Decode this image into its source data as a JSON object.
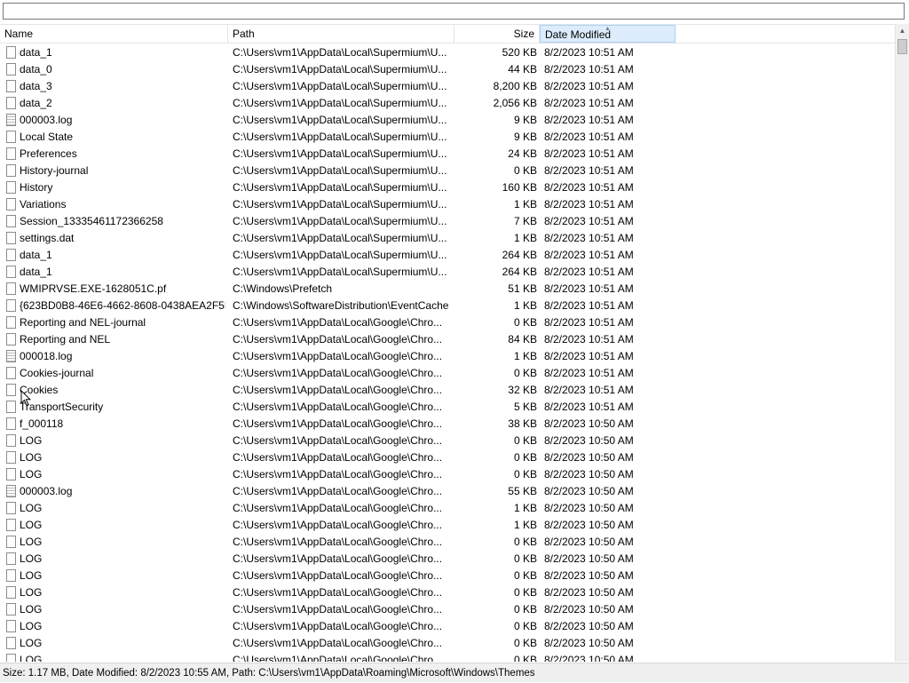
{
  "search": {
    "value": "",
    "placeholder": ""
  },
  "columns": {
    "name": "Name",
    "path": "Path",
    "size": "Size",
    "date": "Date Modified"
  },
  "sorted_column": "Date Modified",
  "rows": [
    {
      "icon": "file-icon",
      "name": "data_1",
      "path": "C:\\Users\\vm1\\AppData\\Local\\Supermium\\U...",
      "size": "520 KB",
      "date": "8/2/2023 10:51 AM"
    },
    {
      "icon": "file-icon",
      "name": "data_0",
      "path": "C:\\Users\\vm1\\AppData\\Local\\Supermium\\U...",
      "size": "44 KB",
      "date": "8/2/2023 10:51 AM"
    },
    {
      "icon": "file-icon",
      "name": "data_3",
      "path": "C:\\Users\\vm1\\AppData\\Local\\Supermium\\U...",
      "size": "8,200 KB",
      "date": "8/2/2023 10:51 AM"
    },
    {
      "icon": "file-icon",
      "name": "data_2",
      "path": "C:\\Users\\vm1\\AppData\\Local\\Supermium\\U...",
      "size": "2,056 KB",
      "date": "8/2/2023 10:51 AM"
    },
    {
      "icon": "log-file-icon",
      "name": "000003.log",
      "path": "C:\\Users\\vm1\\AppData\\Local\\Supermium\\U...",
      "size": "9 KB",
      "date": "8/2/2023 10:51 AM"
    },
    {
      "icon": "file-icon",
      "name": "Local State",
      "path": "C:\\Users\\vm1\\AppData\\Local\\Supermium\\U...",
      "size": "9 KB",
      "date": "8/2/2023 10:51 AM"
    },
    {
      "icon": "file-icon",
      "name": "Preferences",
      "path": "C:\\Users\\vm1\\AppData\\Local\\Supermium\\U...",
      "size": "24 KB",
      "date": "8/2/2023 10:51 AM"
    },
    {
      "icon": "file-icon",
      "name": "History-journal",
      "path": "C:\\Users\\vm1\\AppData\\Local\\Supermium\\U...",
      "size": "0 KB",
      "date": "8/2/2023 10:51 AM"
    },
    {
      "icon": "file-icon",
      "name": "History",
      "path": "C:\\Users\\vm1\\AppData\\Local\\Supermium\\U...",
      "size": "160 KB",
      "date": "8/2/2023 10:51 AM"
    },
    {
      "icon": "file-icon",
      "name": "Variations",
      "path": "C:\\Users\\vm1\\AppData\\Local\\Supermium\\U...",
      "size": "1 KB",
      "date": "8/2/2023 10:51 AM"
    },
    {
      "icon": "file-icon",
      "name": "Session_13335461172366258",
      "path": "C:\\Users\\vm1\\AppData\\Local\\Supermium\\U...",
      "size": "7 KB",
      "date": "8/2/2023 10:51 AM"
    },
    {
      "icon": "file-icon",
      "name": "settings.dat",
      "path": "C:\\Users\\vm1\\AppData\\Local\\Supermium\\U...",
      "size": "1 KB",
      "date": "8/2/2023 10:51 AM"
    },
    {
      "icon": "file-icon",
      "name": "data_1",
      "path": "C:\\Users\\vm1\\AppData\\Local\\Supermium\\U...",
      "size": "264 KB",
      "date": "8/2/2023 10:51 AM"
    },
    {
      "icon": "file-icon",
      "name": "data_1",
      "path": "C:\\Users\\vm1\\AppData\\Local\\Supermium\\U...",
      "size": "264 KB",
      "date": "8/2/2023 10:51 AM"
    },
    {
      "icon": "file-icon",
      "name": "WMIPRVSE.EXE-1628051C.pf",
      "path": "C:\\Windows\\Prefetch",
      "size": "51 KB",
      "date": "8/2/2023 10:51 AM"
    },
    {
      "icon": "file-icon",
      "name": "{623BD0B8-46E6-4662-8608-0438AEA2F5E...",
      "path": "C:\\Windows\\SoftwareDistribution\\EventCache",
      "size": "1 KB",
      "date": "8/2/2023 10:51 AM"
    },
    {
      "icon": "file-icon",
      "name": "Reporting and NEL-journal",
      "path": "C:\\Users\\vm1\\AppData\\Local\\Google\\Chro...",
      "size": "0 KB",
      "date": "8/2/2023 10:51 AM"
    },
    {
      "icon": "file-icon",
      "name": "Reporting and NEL",
      "path": "C:\\Users\\vm1\\AppData\\Local\\Google\\Chro...",
      "size": "84 KB",
      "date": "8/2/2023 10:51 AM"
    },
    {
      "icon": "log-file-icon",
      "name": "000018.log",
      "path": "C:\\Users\\vm1\\AppData\\Local\\Google\\Chro...",
      "size": "1 KB",
      "date": "8/2/2023 10:51 AM"
    },
    {
      "icon": "file-icon",
      "name": "Cookies-journal",
      "path": "C:\\Users\\vm1\\AppData\\Local\\Google\\Chro...",
      "size": "0 KB",
      "date": "8/2/2023 10:51 AM"
    },
    {
      "icon": "file-icon",
      "name": "Cookies",
      "path": "C:\\Users\\vm1\\AppData\\Local\\Google\\Chro...",
      "size": "32 KB",
      "date": "8/2/2023 10:51 AM"
    },
    {
      "icon": "file-icon",
      "name": "TransportSecurity",
      "path": "C:\\Users\\vm1\\AppData\\Local\\Google\\Chro...",
      "size": "5 KB",
      "date": "8/2/2023 10:51 AM"
    },
    {
      "icon": "file-icon",
      "name": "f_000118",
      "path": "C:\\Users\\vm1\\AppData\\Local\\Google\\Chro...",
      "size": "38 KB",
      "date": "8/2/2023 10:50 AM"
    },
    {
      "icon": "file-icon",
      "name": "LOG",
      "path": "C:\\Users\\vm1\\AppData\\Local\\Google\\Chro...",
      "size": "0 KB",
      "date": "8/2/2023 10:50 AM"
    },
    {
      "icon": "file-icon",
      "name": "LOG",
      "path": "C:\\Users\\vm1\\AppData\\Local\\Google\\Chro...",
      "size": "0 KB",
      "date": "8/2/2023 10:50 AM"
    },
    {
      "icon": "file-icon",
      "name": "LOG",
      "path": "C:\\Users\\vm1\\AppData\\Local\\Google\\Chro...",
      "size": "0 KB",
      "date": "8/2/2023 10:50 AM"
    },
    {
      "icon": "log-file-icon",
      "name": "000003.log",
      "path": "C:\\Users\\vm1\\AppData\\Local\\Google\\Chro...",
      "size": "55 KB",
      "date": "8/2/2023 10:50 AM"
    },
    {
      "icon": "file-icon",
      "name": "LOG",
      "path": "C:\\Users\\vm1\\AppData\\Local\\Google\\Chro...",
      "size": "1 KB",
      "date": "8/2/2023 10:50 AM"
    },
    {
      "icon": "file-icon",
      "name": "LOG",
      "path": "C:\\Users\\vm1\\AppData\\Local\\Google\\Chro...",
      "size": "1 KB",
      "date": "8/2/2023 10:50 AM"
    },
    {
      "icon": "file-icon",
      "name": "LOG",
      "path": "C:\\Users\\vm1\\AppData\\Local\\Google\\Chro...",
      "size": "0 KB",
      "date": "8/2/2023 10:50 AM"
    },
    {
      "icon": "file-icon",
      "name": "LOG",
      "path": "C:\\Users\\vm1\\AppData\\Local\\Google\\Chro...",
      "size": "0 KB",
      "date": "8/2/2023 10:50 AM"
    },
    {
      "icon": "file-icon",
      "name": "LOG",
      "path": "C:\\Users\\vm1\\AppData\\Local\\Google\\Chro...",
      "size": "0 KB",
      "date": "8/2/2023 10:50 AM"
    },
    {
      "icon": "file-icon",
      "name": "LOG",
      "path": "C:\\Users\\vm1\\AppData\\Local\\Google\\Chro...",
      "size": "0 KB",
      "date": "8/2/2023 10:50 AM"
    },
    {
      "icon": "file-icon",
      "name": "LOG",
      "path": "C:\\Users\\vm1\\AppData\\Local\\Google\\Chro...",
      "size": "0 KB",
      "date": "8/2/2023 10:50 AM"
    },
    {
      "icon": "file-icon",
      "name": "LOG",
      "path": "C:\\Users\\vm1\\AppData\\Local\\Google\\Chro...",
      "size": "0 KB",
      "date": "8/2/2023 10:50 AM"
    },
    {
      "icon": "file-icon",
      "name": "LOG",
      "path": "C:\\Users\\vm1\\AppData\\Local\\Google\\Chro...",
      "size": "0 KB",
      "date": "8/2/2023 10:50 AM"
    },
    {
      "icon": "file-icon",
      "name": "LOG",
      "path": "C:\\Users\\vm1\\AppData\\Local\\Google\\Chro...",
      "size": "0 KB",
      "date": "8/2/2023 10:50 AM"
    }
  ],
  "statusbar": {
    "text": "Size: 1.17 MB, Date Modified: 8/2/2023 10:55 AM, Path: C:\\Users\\vm1\\AppData\\Roaming\\Microsoft\\Windows\\Themes"
  },
  "colors": {
    "sorted_header_bg": "#dcecfc",
    "sorted_header_border": "#a9d3f6",
    "statusbar_bg": "#f0f0f0"
  }
}
